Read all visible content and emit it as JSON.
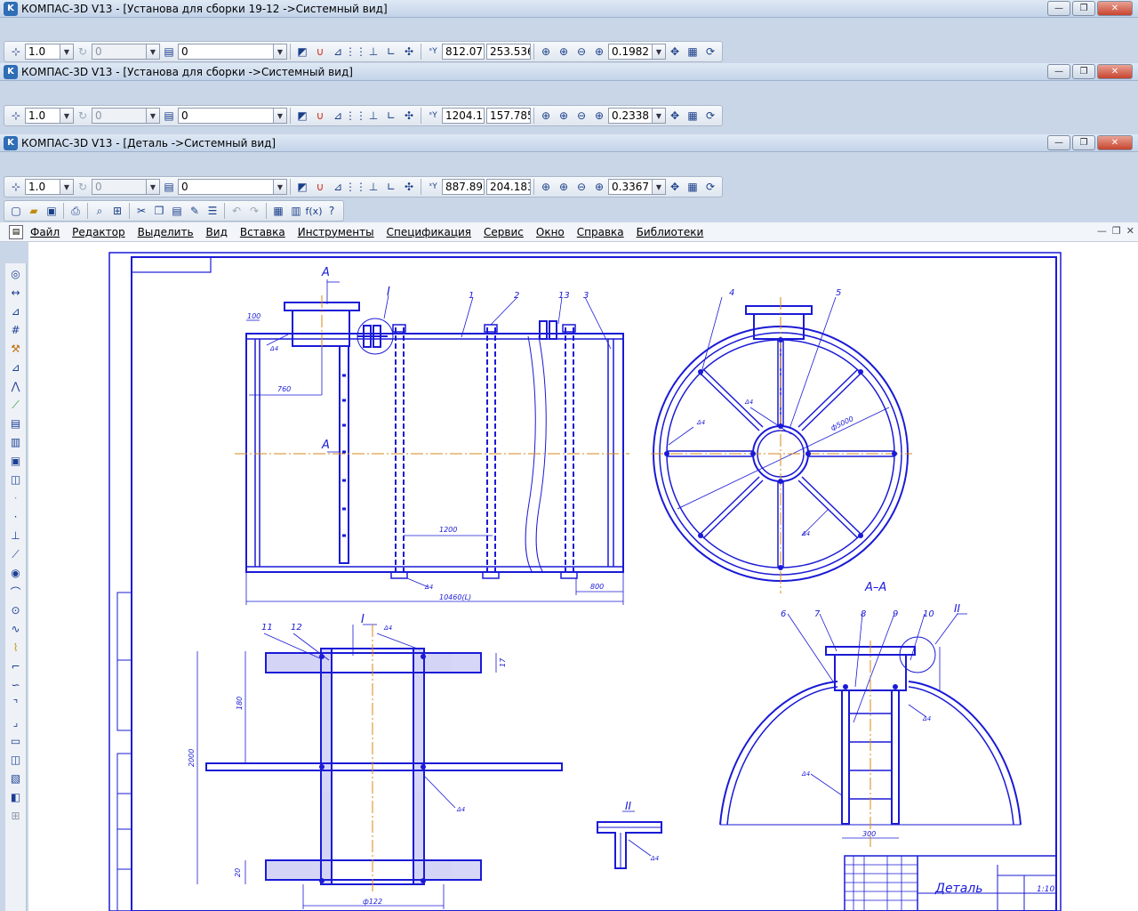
{
  "windows": [
    {
      "title": "КОМПАС-3D V13 - [Установа для  сборки 19-12 ->Системный вид]",
      "toolbar": {
        "step": "1.0",
        "angle": "0",
        "layer": "0",
        "x": "812.07",
        "y": "253.536",
        "zoom": "0.1982"
      }
    },
    {
      "title": "КОМПАС-3D V13 - [Установа для сборки ->Системный вид]",
      "toolbar": {
        "step": "1.0",
        "angle": "0",
        "layer": "0",
        "x": "1204.1",
        "y": "157.785",
        "zoom": "0.2338"
      }
    },
    {
      "title": "КОМПАС-3D V13 - [Деталь ->Системный вид]",
      "toolbar": {
        "step": "1.0",
        "angle": "0",
        "layer": "0",
        "x": "887.893",
        "y": "204.183",
        "zoom": "0.3367"
      }
    }
  ],
  "window_controls": {
    "minimize": "—",
    "restore": "❐",
    "close": "✕"
  },
  "standard_toolbar_icons": [
    "new-document-icon",
    "open-folder-icon",
    "save-icon",
    "print-icon",
    "preview-icon",
    "manager-icon",
    "cut-icon",
    "copy-icon",
    "paste-icon",
    "properties-icon",
    "tree-icon",
    "undo-icon",
    "redo-icon",
    "library-icon",
    "variables-icon",
    "fx-icon",
    "help-icon"
  ],
  "menu": [
    "Файл",
    "Редактор",
    "Выделить",
    "Вид",
    "Вставка",
    "Инструменты",
    "Спецификация",
    "Сервис",
    "Окно",
    "Справка",
    "Библиотеки"
  ],
  "drawing": {
    "view_labels": {
      "section_a": "А",
      "section_aa": "А–А",
      "detail_1": "I",
      "detail_2": "II"
    },
    "callouts": [
      "1",
      "2",
      "13",
      "3",
      "4",
      "5",
      "6",
      "7",
      "8",
      "9",
      "10",
      "11",
      "12"
    ],
    "dimensions": {
      "d100": "100",
      "d760": "760",
      "d1200": "1200",
      "d800": "800",
      "d10460": "10460(L)",
      "d300": "300",
      "d2000": "2000",
      "d180": "180",
      "d122": "ф122",
      "d17": "17",
      "d20": "20",
      "d5000": "ф5000"
    },
    "welds": "Δ4",
    "title_block": {
      "name": "Деталь",
      "scale": "1:10"
    }
  },
  "colors": {
    "line": "#1a1ad6",
    "axis": "#d58a1a",
    "frame": "#1a1ad6"
  }
}
